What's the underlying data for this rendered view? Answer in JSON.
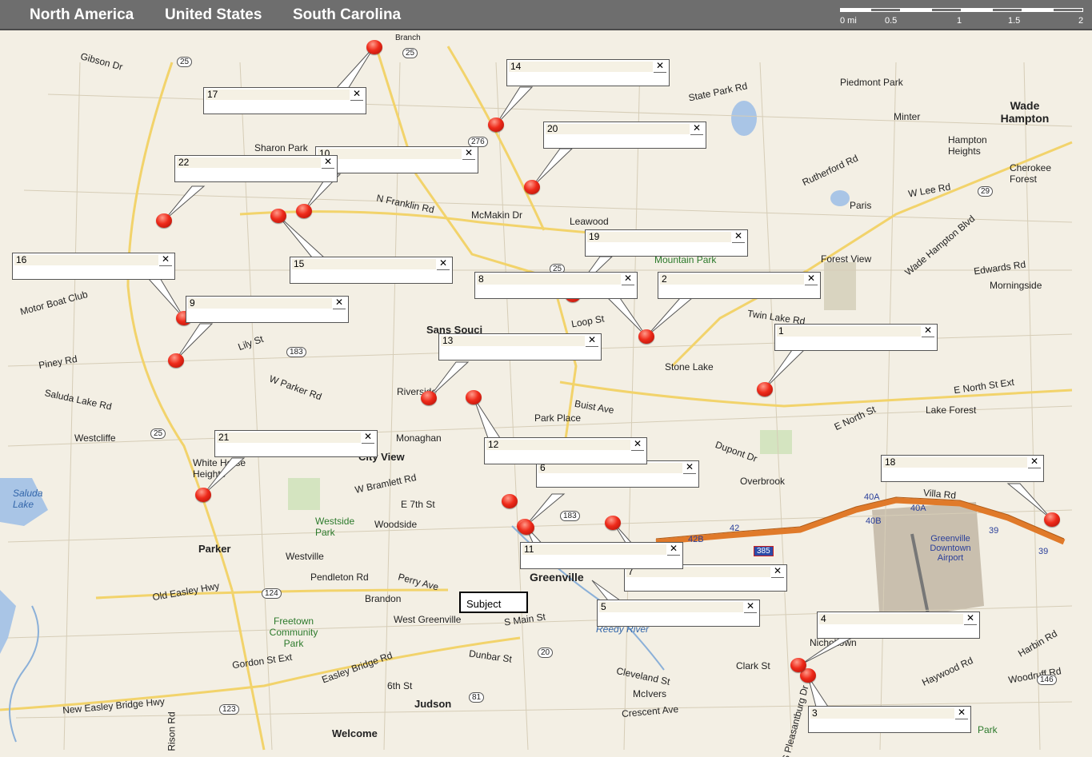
{
  "breadcrumbs": [
    "North America",
    "United States",
    "South Carolina"
  ],
  "scale": {
    "unit_label": "0 mi",
    "ticks": [
      "0.5",
      "1",
      "1.5",
      "2"
    ]
  },
  "subject_label": "Subject",
  "callouts": [
    {
      "num": "1"
    },
    {
      "num": "2"
    },
    {
      "num": "3"
    },
    {
      "num": "4"
    },
    {
      "num": "5"
    },
    {
      "num": "6"
    },
    {
      "num": "7"
    },
    {
      "num": "8"
    },
    {
      "num": "9"
    },
    {
      "num": "10"
    },
    {
      "num": "11"
    },
    {
      "num": "12"
    },
    {
      "num": "13"
    },
    {
      "num": "14"
    },
    {
      "num": "15"
    },
    {
      "num": "16"
    },
    {
      "num": "17"
    },
    {
      "num": "18"
    },
    {
      "num": "19"
    },
    {
      "num": "20"
    },
    {
      "num": "21"
    },
    {
      "num": "22"
    }
  ],
  "close_glyph": "✕",
  "place_labels": {
    "gibson_dr": "Gibson Dr",
    "sharon_park": "Sharon Park",
    "n_franklin_rd": "N Franklin Rd",
    "mcmakin_dr": "McMakin Dr",
    "leawood": "Leawood",
    "state_park_rd": "State Park Rd",
    "piedmont_park": "Piedmont Park",
    "minter": "Minter",
    "wade_hampton": "Wade Hampton",
    "hampton_heights": "Hampton Heights",
    "cherokee_forest": "Cherokee Forest",
    "rutherford_rd": "Rutherford Rd",
    "paris": "Paris",
    "w_lee_rd": "W Lee Rd",
    "forest_view": "Forest View",
    "edwards_rd": "Edwards Rd",
    "morningside": "Morningside",
    "sans_souci": "Sans Souci",
    "stone_lake": "Stone Lake",
    "twin_lake_rd": "Twin Lake Rd",
    "riverside": "Riverside",
    "park_place": "Park Place",
    "buist_ave": "Buist Ave",
    "e_north_st": "E North St",
    "lake_forest": "Lake Forest",
    "e_north_st_ext": "E North St Ext",
    "monaghan": "Monaghan",
    "city_view": "City View",
    "westcliffe": "Westcliffe",
    "white_horse_heights": "White Horse Heights",
    "overbrook": "Overbrook",
    "villa_rd": "Villa Rd",
    "greenville_airport": "Greenville Downtown Airport",
    "westside_park": "Westside Park",
    "woodside": "Woodside",
    "parker": "Parker",
    "westville": "Westville",
    "pendleton_rd": "Pendleton Rd",
    "brandon": "Brandon",
    "greenville": "Greenville",
    "west_greenville": "West Greenville",
    "old_easley_hwy": "Old Easley Hwy",
    "freetown_park": "Freetown Community Park",
    "gordon_st_ext": "Gordon St Ext",
    "easley_bridge_rd": "Easley Bridge Rd",
    "dunbar_st": "Dunbar St",
    "clark_st": "Clark St",
    "nicholtown": "Nicholtown",
    "cleveland_st": "Cleveland St",
    "mcivers": "McIvers",
    "crescent_ave": "Crescent Ave",
    "judson": "Judson",
    "welcome": "Welcome",
    "new_easley_bridge_hwy": "New Easley Bridge Hwy",
    "saluda_lake": "Saluda Lake",
    "saluda_lake_rd": "Saluda Lake Rd",
    "piney_rd": "Piney Rd",
    "motor_boat_club": "Motor Boat Club",
    "w_parker_rd": "W Parker Rd",
    "lily_st": "Lily St",
    "woodruff_rd": "Woodruff Rd",
    "park": "Park",
    "branch": "Branch",
    "reedy_river": "Reedy River",
    "w_bramlett_rd": "W Bramlett Rd",
    "e_7th_st": "E 7th St",
    "perry_ave": "Perry Ave",
    "s_main_st": "S Main St",
    "loop_st": "Loop St",
    "dupont_dr": "Dupont Dr",
    "edwards_rd2": "Edwards Rd",
    "wade_hampton_blvd": "Wade Hampton Blvd",
    "6th_st": "6th St",
    "rison_rd": "Rison Rd",
    "haywood_rd": "Haywood Rd",
    "harbin_rd": "Harbin Rd",
    "s_pleasantburg": "S Pleasantburg Dr",
    "mountain_park": "Mountain Park"
  },
  "shields": [
    "25",
    "25",
    "276",
    "25",
    "183",
    "25",
    "124",
    "123",
    "81",
    "20",
    "183",
    "29",
    "146",
    "385",
    "42B",
    "42",
    "40A",
    "40A",
    "40B",
    "39",
    "39"
  ],
  "colors": {
    "marker": "#ee2a1a",
    "interstate": "#e07a2a",
    "topbar": "#6e6e6e",
    "land": "#f3efe4"
  }
}
